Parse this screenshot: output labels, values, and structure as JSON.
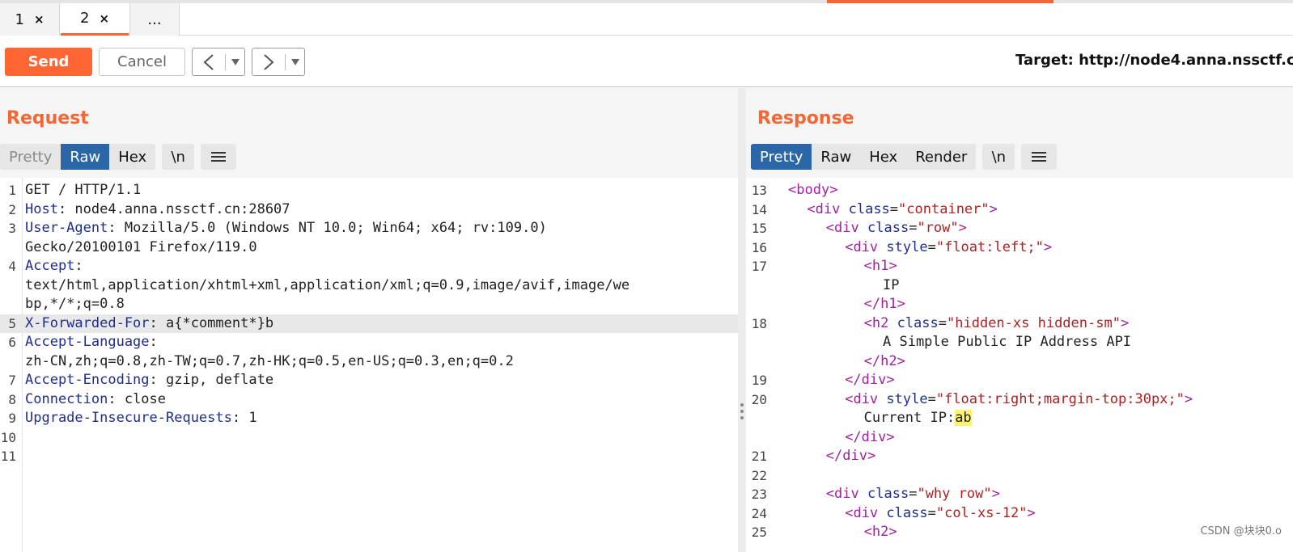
{
  "tabs": [
    {
      "label": "1",
      "close": "×"
    },
    {
      "label": "2",
      "close": "×"
    },
    {
      "label": "..."
    }
  ],
  "toolbar": {
    "send_label": "Send",
    "cancel_label": "Cancel",
    "target_label": "Target: http://node4.anna.nssctf.c"
  },
  "request": {
    "title": "Request",
    "views": [
      "Pretty",
      "Raw",
      "Hex"
    ],
    "newline_label": "\\n",
    "line_numbers": [
      "1",
      "2",
      "3",
      "",
      "4",
      "",
      "",
      "5",
      "6",
      "",
      "7",
      "8",
      "9",
      "10",
      "11"
    ],
    "lines": [
      {
        "plain": "GET / HTTP/1.1"
      },
      {
        "key": "Host",
        "value": ": node4.anna.nssctf.cn:28607"
      },
      {
        "key": "User-Agent",
        "value": ": Mozilla/5.0 (Windows NT 10.0; Win64; x64; rv:109.0)"
      },
      {
        "plain": "Gecko/20100101 Firefox/119.0"
      },
      {
        "key": "Accept",
        "value": ":"
      },
      {
        "plain": "text/html,application/xhtml+xml,application/xml;q=0.9,image/avif,image/we"
      },
      {
        "plain": "bp,*/*;q=0.8"
      },
      {
        "key": "X-Forwarded-For",
        "value": ": a{*comment*}b"
      },
      {
        "key": "Accept-Language",
        "value": ":"
      },
      {
        "plain": "zh-CN,zh;q=0.8,zh-TW;q=0.7,zh-HK;q=0.5,en-US;q=0.3,en;q=0.2"
      },
      {
        "key": "Accept-Encoding",
        "value": ": gzip, deflate"
      },
      {
        "key": "Connection",
        "value": ": close"
      },
      {
        "key": "Upgrade-Insecure-Requests",
        "value": ": 1"
      },
      {
        "plain": ""
      },
      {
        "plain": ""
      }
    ]
  },
  "response": {
    "title": "Response",
    "views": [
      "Pretty",
      "Raw",
      "Hex",
      "Render"
    ],
    "newline_label": "\\n",
    "line_numbers": [
      "13",
      "14",
      "15",
      "16",
      "17",
      "",
      "",
      "18",
      "",
      "",
      "19",
      "20",
      "",
      "",
      "21",
      "22",
      "23",
      "24",
      "25"
    ],
    "lines": [
      {
        "open": "<",
        "tag": "body",
        "close": ">"
      },
      {
        "open": "<",
        "tag": "div",
        "attr": "class",
        "eq": "=",
        "val": "\"container\"",
        "close": ">"
      },
      {
        "open": "<",
        "tag": "div",
        "attr": "class",
        "eq": "=",
        "val": "\"row\"",
        "close": ">"
      },
      {
        "open": "<",
        "tag": "div",
        "attr": "style",
        "eq": "=",
        "val": "\"float:left;\"",
        "close": ">"
      },
      {
        "open": "<",
        "tag": "h1",
        "close": ">"
      },
      {
        "text": "IP"
      },
      {
        "open": "</",
        "tag": "h1",
        "close": ">"
      },
      {
        "open": "<",
        "tag": "h2",
        "attr": "class",
        "eq": "=",
        "val": "\"hidden-xs hidden-sm\"",
        "close": ">"
      },
      {
        "text": "A Simple Public IP Address API"
      },
      {
        "open": "</",
        "tag": "h2",
        "close": ">"
      },
      {
        "open": "</",
        "tag": "div",
        "close": ">"
      },
      {
        "open": "<",
        "tag": "div",
        "attr": "style",
        "eq": "=",
        "val": "\"float:right;margin-top:30px;\"",
        "close": ">"
      },
      {
        "text": "Current IP:",
        "highlight": "ab"
      },
      {
        "open": "</",
        "tag": "div",
        "close": ">"
      },
      {
        "open": "</",
        "tag": "div",
        "close": ">"
      },
      {},
      {
        "open": "<",
        "tag": "div",
        "attr": "class",
        "eq": "=",
        "val": "\"why row\"",
        "close": ">"
      },
      {
        "open": "<",
        "tag": "div",
        "attr": "class",
        "eq": "=",
        "val": "\"col-xs-12\"",
        "close": ">"
      },
      {
        "open": "<",
        "tag": "h2",
        "close": ">"
      }
    ]
  },
  "watermark": "CSDN @块块0.o",
  "colors": {
    "accent": "#f26735",
    "active_view": "#2b67a6",
    "header_key": "#1f2d8f",
    "tag": "#a020a0",
    "attr_value": "#b02020",
    "match_highlight": "#fff36b"
  }
}
